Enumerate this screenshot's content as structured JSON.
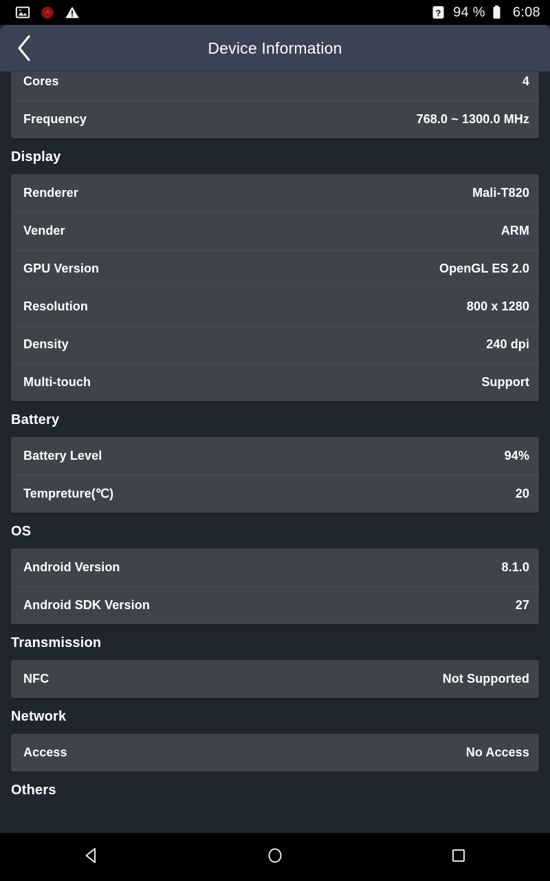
{
  "statusbar": {
    "left_icons": [
      {
        "name": "image-icon",
        "glyph": "image"
      },
      {
        "name": "flame-app-icon",
        "glyph": "flame",
        "color": "#b0181a"
      },
      {
        "name": "warning-triangle-icon",
        "glyph": "warning"
      }
    ],
    "signal_icon": "unknown-signal-icon",
    "battery_percent": "94 %",
    "battery_icon": "battery-icon",
    "time": "6:08"
  },
  "appbar": {
    "back_icon": "back-chevron-icon",
    "title": "Device Information",
    "background": "#3b4255"
  },
  "sections": [
    {
      "name": "cpu-section",
      "title": "",
      "clipped_top": true,
      "rows": [
        {
          "label": "Cores",
          "value": "4"
        },
        {
          "label": "Frequency",
          "value": "768.0 ~ 1300.0 MHz"
        }
      ]
    },
    {
      "name": "display-section",
      "title": "Display",
      "clipped_top": false,
      "rows": [
        {
          "label": "Renderer",
          "value": "Mali-T820"
        },
        {
          "label": "Vender",
          "value": "ARM"
        },
        {
          "label": "GPU Version",
          "value": "OpenGL ES 2.0"
        },
        {
          "label": "Resolution",
          "value": "800 x 1280"
        },
        {
          "label": "Density",
          "value": "240 dpi"
        },
        {
          "label": "Multi-touch",
          "value": "Support"
        }
      ]
    },
    {
      "name": "battery-section",
      "title": "Battery",
      "clipped_top": false,
      "rows": [
        {
          "label": "Battery Level",
          "value": "94%"
        },
        {
          "label": "Tempreture(℃)",
          "value": "20"
        }
      ]
    },
    {
      "name": "os-section",
      "title": "OS",
      "clipped_top": false,
      "rows": [
        {
          "label": "Android Version",
          "value": "8.1.0"
        },
        {
          "label": "Android SDK Version",
          "value": "27"
        }
      ]
    },
    {
      "name": "transmission-section",
      "title": "Transmission",
      "clipped_top": false,
      "rows": [
        {
          "label": "NFC",
          "value": "Not Supported"
        }
      ]
    },
    {
      "name": "network-section",
      "title": "Network",
      "clipped_top": false,
      "rows": [
        {
          "label": "Access",
          "value": "No Access"
        }
      ]
    },
    {
      "name": "others-section",
      "title": "Others",
      "clipped_top": false,
      "rows": []
    }
  ],
  "navbar": {
    "back_icon": "nav-back-triangle-icon",
    "home_icon": "nav-home-circle-icon",
    "recents_icon": "nav-recents-square-icon"
  },
  "colors": {
    "page_background": "#20262e",
    "card_background": "#3e4449",
    "appbar_background": "#3b4255",
    "text_primary": "#ffffff"
  }
}
